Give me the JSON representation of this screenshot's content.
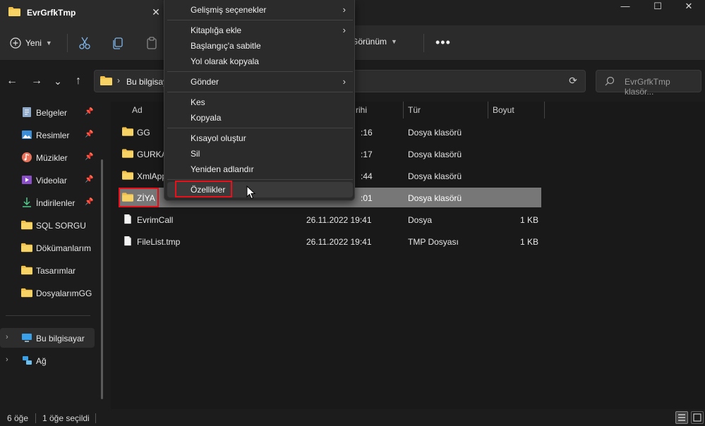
{
  "tab": {
    "title": "EvrGrfkTmp",
    "close_glyph": "✕"
  },
  "window": {
    "minimize": "—",
    "maximize": "☐",
    "close": "✕"
  },
  "toolbar": {
    "new_label": "Yeni",
    "view_label": "Görünüm",
    "more": "•••"
  },
  "nav": {
    "back": "←",
    "forward": "→",
    "recent": "⌄",
    "up": "↑"
  },
  "address": {
    "path": "Bu bilgisayar",
    "chevron": "›",
    "refresh": "⟳"
  },
  "search": {
    "placeholder": "EvrGrfkTmp klasör..."
  },
  "sidebar": {
    "items": [
      {
        "label": "Belgeler",
        "icon": "documents-icon",
        "pinned": true
      },
      {
        "label": "Resimler",
        "icon": "pictures-icon",
        "pinned": true
      },
      {
        "label": "Müzikler",
        "icon": "music-icon",
        "pinned": true
      },
      {
        "label": "Videolar",
        "icon": "videos-icon",
        "pinned": true
      },
      {
        "label": "İndirilenler",
        "icon": "downloads-icon",
        "pinned": true
      },
      {
        "label": "SQL SORGU",
        "icon": "folder-icon",
        "pinned": false
      },
      {
        "label": "Dökümanlarım",
        "icon": "folder-icon",
        "pinned": false
      },
      {
        "label": "Tasarımlar",
        "icon": "folder-icon",
        "pinned": false
      },
      {
        "label": "DosyalarımGG",
        "icon": "folder-icon",
        "pinned": false
      }
    ],
    "this_pc": "Bu bilgisayar",
    "network": "Ağ"
  },
  "columns": {
    "name": "Ad",
    "date": "rihi",
    "type": "Tür",
    "size": "Boyut"
  },
  "files": [
    {
      "name": "GG",
      "date": ":16",
      "type": "Dosya klasörü",
      "size": "",
      "kind": "folder"
    },
    {
      "name": "GURKA",
      "date": ":17",
      "type": "Dosya klasörü",
      "size": "",
      "kind": "folder"
    },
    {
      "name": "XmlApp",
      "date": ":44",
      "type": "Dosya klasörü",
      "size": "",
      "kind": "folder"
    },
    {
      "name": "ZİYA",
      "date": ":01",
      "type": "Dosya klasörü",
      "size": "",
      "kind": "folder",
      "selected": true
    },
    {
      "name": "EvrimCall",
      "date": "26.11.2022 19:41",
      "type": "Dosya",
      "size": "1 KB",
      "kind": "file"
    },
    {
      "name": "FileList.tmp",
      "date": "26.11.2022 19:41",
      "type": "TMP Dosyası",
      "size": "1 KB",
      "kind": "file"
    }
  ],
  "context_menu": {
    "advanced": "Gelişmiş seçenekler",
    "add_library": "Kitaplığa ekle",
    "pin_start": "Başlangıç'a sabitle",
    "copy_path": "Yol olarak kopyala",
    "send_to": "Gönder",
    "cut": "Kes",
    "copy": "Kopyala",
    "create_shortcut": "Kısayol oluştur",
    "delete": "Sil",
    "rename": "Yeniden adlandır",
    "properties": "Özellikler",
    "arrow": "›"
  },
  "status": {
    "count": "6 öğe",
    "selected": "1 öğe seçildi"
  },
  "colors": {
    "folder": "#f0c04a",
    "highlight": "#e8101a",
    "selection": "#777777"
  }
}
